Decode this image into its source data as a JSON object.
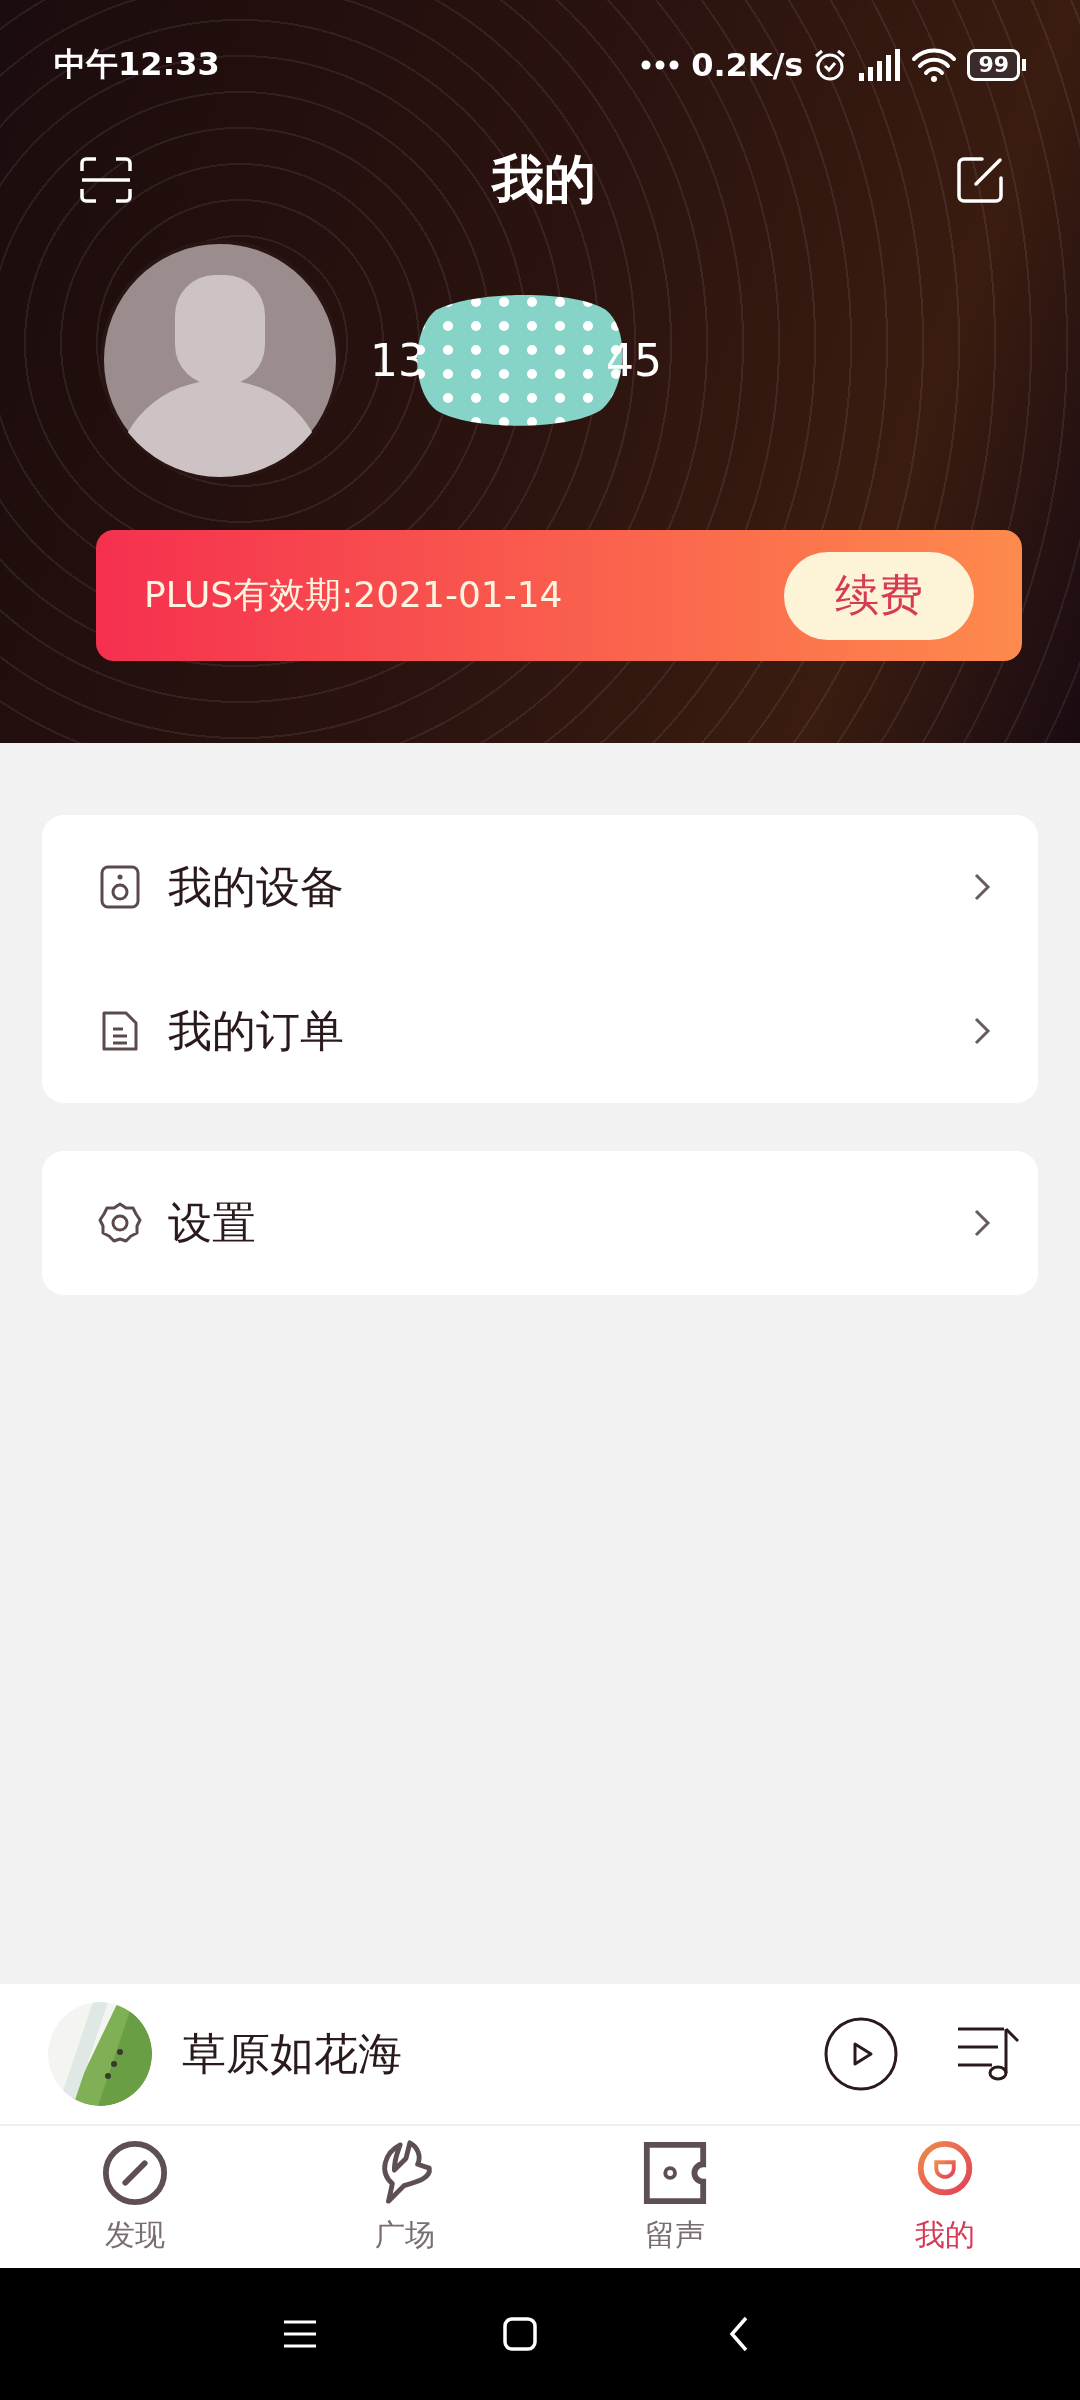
{
  "status_bar": {
    "time": "中午12:33",
    "network_speed": "0.2K/s",
    "battery": "99"
  },
  "header": {
    "title": "我的"
  },
  "profile": {
    "phone_start": "13",
    "phone_end": "45"
  },
  "membership": {
    "label": "PLUS有效期:2021-01-14",
    "button": "续费"
  },
  "menu_groups": [
    {
      "items": [
        {
          "kind": "device",
          "label": "我的设备"
        },
        {
          "kind": "order",
          "label": "我的订单"
        }
      ]
    },
    {
      "items": [
        {
          "kind": "settings",
          "label": "设置"
        }
      ]
    }
  ],
  "now_playing": {
    "title": "草原如花海"
  },
  "tabs": [
    {
      "kind": "discover",
      "label": "发现",
      "selected": false
    },
    {
      "kind": "square",
      "label": "广场",
      "selected": false
    },
    {
      "kind": "voice",
      "label": "留声",
      "selected": false
    },
    {
      "kind": "me",
      "label": "我的",
      "selected": true
    }
  ]
}
